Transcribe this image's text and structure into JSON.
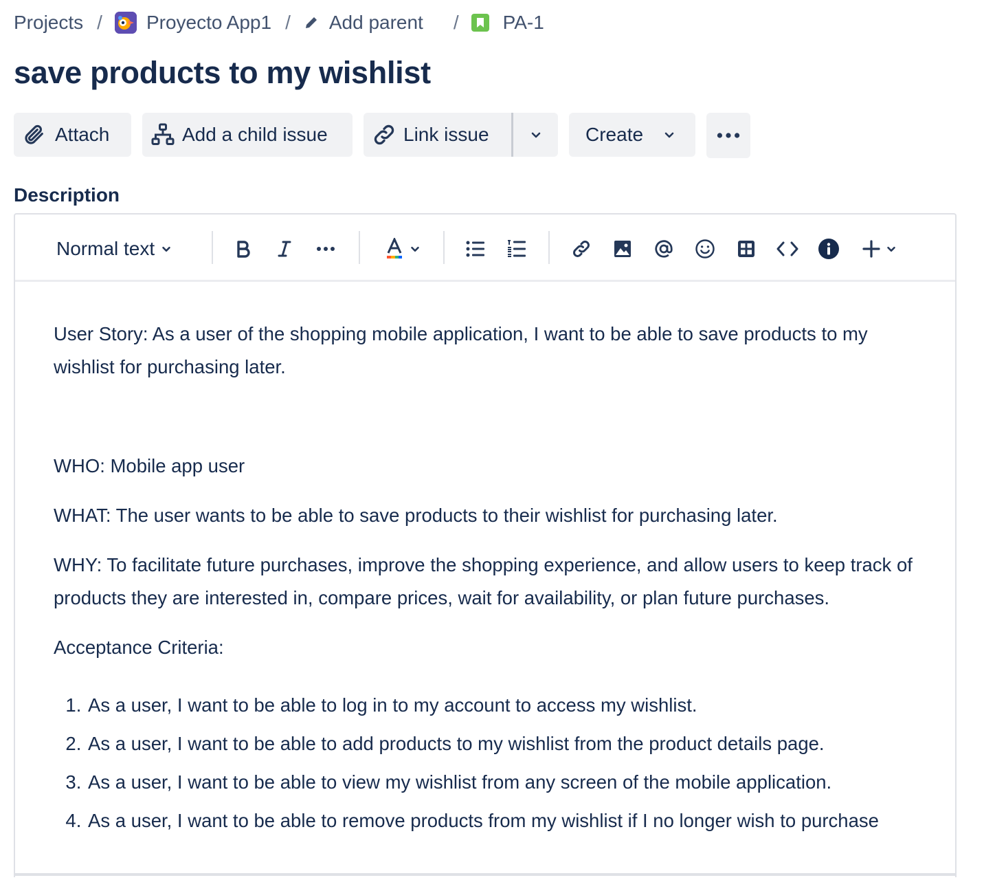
{
  "breadcrumb": {
    "projects": "Projects",
    "project_name": "Proyecto App1",
    "add_parent": "Add parent",
    "issue_key": "PA-1",
    "separator": "/"
  },
  "title": "save products to my wishlist",
  "actions": {
    "attach": "Attach",
    "add_child": "Add a child issue",
    "link_issue": "Link issue",
    "create": "Create"
  },
  "description_label": "Description",
  "toolbar": {
    "text_style": "Normal text",
    "icons": [
      "bold-icon",
      "italic-icon",
      "more-formatting-icon",
      "text-color-icon",
      "bullet-list-icon",
      "numbered-list-icon",
      "link-icon",
      "image-icon",
      "mention-icon",
      "emoji-icon",
      "table-icon",
      "code-icon",
      "info-icon",
      "insert-plus-icon"
    ]
  },
  "description": {
    "user_story": "User Story: As a user of the shopping mobile application, I want to be able to save products to my wishlist for purchasing later.",
    "who": "WHO: Mobile app user",
    "what": "WHAT: The user wants to be able to save products to their wishlist for purchasing later.",
    "why": "WHY: To facilitate future purchases, improve the shopping experience, and allow users to keep track of products they are interested in, compare prices, wait for availability, or plan future purchases.",
    "criteria_heading": "Acceptance Criteria:",
    "criteria": [
      "As a user, I want to be able to log in to my account to access my wishlist.",
      "As a user, I want to be able to add products to my wishlist from the product details page.",
      "As a user, I want to be able to view my wishlist from any screen of the mobile application.",
      "As a user, I want to be able to remove products from my wishlist if I no longer wish to purchase"
    ]
  },
  "colors": {
    "text": "#172b4d",
    "button_bg": "#f1f2f4",
    "border": "#dfe1e6",
    "story_green": "#6cc34e",
    "project_purple": "#5e4db2"
  }
}
